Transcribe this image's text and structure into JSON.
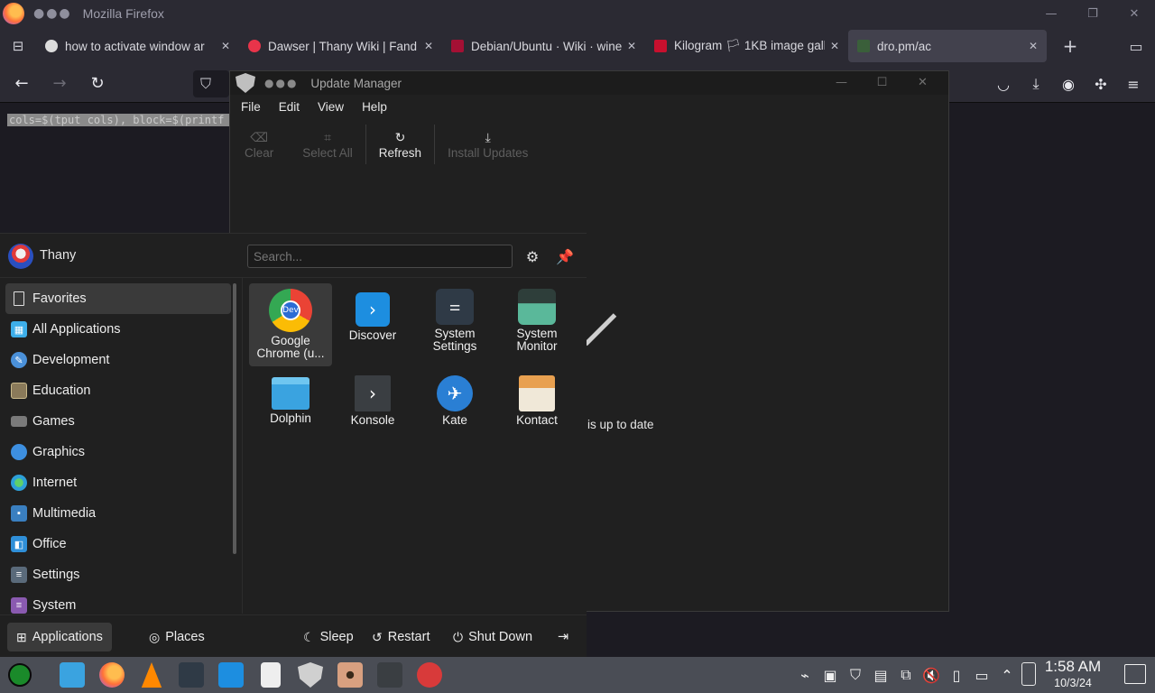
{
  "firefox": {
    "window_title": "Mozilla Firefox",
    "tabs": [
      {
        "label": "how to activate window ar",
        "favicon_color": "#dcdcdc"
      },
      {
        "label": "Dawser | Thany Wiki | Fand",
        "favicon_color": "#e8344a"
      },
      {
        "label": "Debian/Ubuntu · Wiki · wine",
        "favicon_color": "#a41034"
      },
      {
        "label": "Kilogram 🏳 1KB image gall",
        "favicon_color": "#c8102e"
      },
      {
        "label": "dro.pm/ac",
        "favicon_color": "#3a5f3a"
      }
    ],
    "page_text": "cols=$(tput cols), block=$(printf"
  },
  "update_manager": {
    "title": "Update Manager",
    "menu": [
      "File",
      "Edit",
      "View",
      "Help"
    ],
    "toolbar": {
      "clear": "Clear",
      "select_all": "Select All",
      "refresh": "Refresh",
      "install": "Install Updates"
    },
    "status": "is up to date"
  },
  "launcher": {
    "user": "Thany",
    "search_placeholder": "Search...",
    "categories": [
      {
        "label": "Favorites",
        "icon": "bookmark-icon",
        "color": "#3a3a3a"
      },
      {
        "label": "All Applications",
        "icon": "grid-icon",
        "color": "#3daee9"
      },
      {
        "label": "Development",
        "icon": "development-icon",
        "color": "#4a90d9"
      },
      {
        "label": "Education",
        "icon": "education-icon",
        "color": "#8a7a5a"
      },
      {
        "label": "Games",
        "icon": "gamepad-icon",
        "color": "#7a7a7a"
      },
      {
        "label": "Graphics",
        "icon": "graphics-icon",
        "color": "#3d8fe0"
      },
      {
        "label": "Internet",
        "icon": "globe-icon",
        "color": "#2d9fd8"
      },
      {
        "label": "Multimedia",
        "icon": "multimedia-icon",
        "color": "#3a7fc0"
      },
      {
        "label": "Office",
        "icon": "office-icon",
        "color": "#2f8fd8"
      },
      {
        "label": "Settings",
        "icon": "settings-icon",
        "color": "#5a6a7a"
      },
      {
        "label": "System",
        "icon": "system-icon",
        "color": "#8a5ab0"
      }
    ],
    "apps": [
      {
        "name": "Google Chrome (u...",
        "icon": "chrome-dev-icon",
        "color": "#2b6cd4"
      },
      {
        "name": "Discover",
        "icon": "discover-icon",
        "color": "#1d8ee0"
      },
      {
        "name": "System Settings",
        "icon": "system-settings-icon",
        "color": "#2f3a46"
      },
      {
        "name": "System Monitor",
        "icon": "system-monitor-icon",
        "color": "#2e3e3a"
      },
      {
        "name": "Dolphin",
        "icon": "dolphin-icon",
        "color": "#3aa3e0"
      },
      {
        "name": "Konsole",
        "icon": "konsole-icon",
        "color": "#3a3e42"
      },
      {
        "name": "Kate",
        "icon": "kate-icon",
        "color": "#2a7fd4"
      },
      {
        "name": "Kontact",
        "icon": "kontact-icon",
        "color": "#d8b070"
      }
    ],
    "footer": {
      "applications": "Applications",
      "places": "Places",
      "sleep": "Sleep",
      "restart": "Restart",
      "shutdown": "Shut Down"
    }
  },
  "taskbar": {
    "time": "1:58 AM",
    "date": "10/3/24"
  }
}
